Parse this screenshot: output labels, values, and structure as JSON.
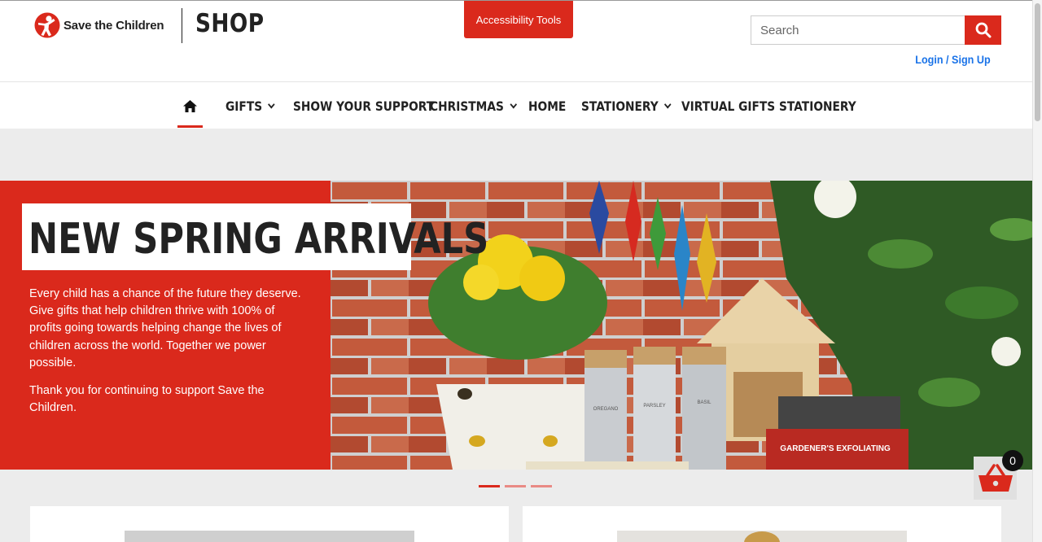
{
  "brand": {
    "logo_text": "Save the Children",
    "shop_title": "SHOP",
    "accent_color": "#da291c"
  },
  "header": {
    "accessibility_label": "Accessibility Tools",
    "search_placeholder": "Search",
    "login_label": "Login / Sign Up"
  },
  "nav": {
    "items": [
      {
        "label": "GIFTS",
        "dropdown": true
      },
      {
        "label": "SHOW YOUR SUPPORT",
        "dropdown": false
      },
      {
        "label": "CHRISTMAS",
        "dropdown": true
      },
      {
        "label": "HOME",
        "dropdown": false
      },
      {
        "label": "STATIONERY",
        "dropdown": true
      },
      {
        "label": "VIRTUAL GIFTS",
        "dropdown": false
      },
      {
        "label": "STATIONERY",
        "dropdown": false
      }
    ]
  },
  "hero": {
    "title": "NEW SPRING ARRIVALS",
    "paragraph1": "Every child has a chance of the future they deserve. Give gifts that help children thrive with 100% of profits going towards helping change the lives of children across the world. Together we power possible.",
    "paragraph2": "Thank you for continuing to support Save the Children.",
    "jar_labels": [
      "OREGANO",
      "PARSLEY",
      "BASIL"
    ],
    "box_labels": [
      "GARDENER'S EXFOLIATING"
    ]
  },
  "carousel": {
    "slide_count": 3,
    "active_index": 0
  },
  "cart": {
    "count": "0"
  }
}
